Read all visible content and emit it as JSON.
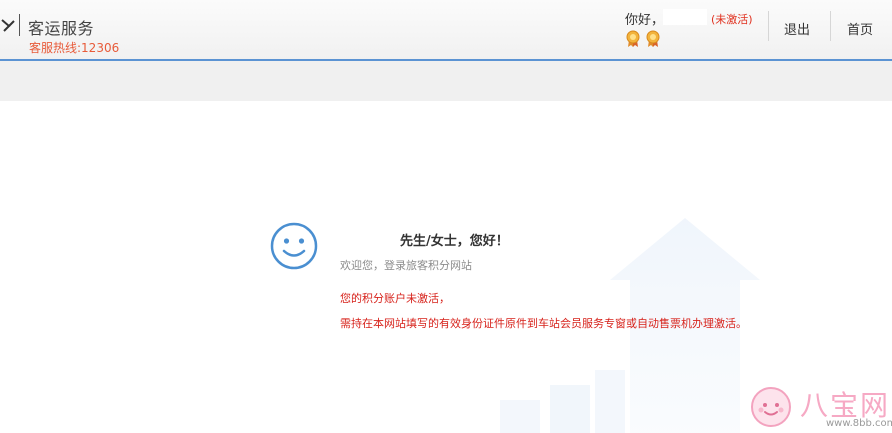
{
  "header": {
    "app_title": "客运服务",
    "hotline": "客服热线:12306",
    "greeting": "你好，",
    "account_status": "(未激活)",
    "logout_label": "退出",
    "home_label": "首页",
    "medals": [
      "medal-icon",
      "medal-icon"
    ]
  },
  "message": {
    "title": "先生/女士，您好！",
    "subtitle": "欢迎您，登录旅客积分网站",
    "warning_line1": "您的积分账户未激活，",
    "warning_line2": "需持在本网站填写的有效身份证件原件到车站会员服务专窗或自动售票机办理激活。"
  },
  "watermark": {
    "brand": "八宝网",
    "url": "www.8bb.com"
  },
  "colors": {
    "accent_blue": "#5b93d3",
    "warning_red": "#d7221b",
    "hotline_orange": "#e85b3a",
    "watermark_pink": "#f6a9c4"
  }
}
